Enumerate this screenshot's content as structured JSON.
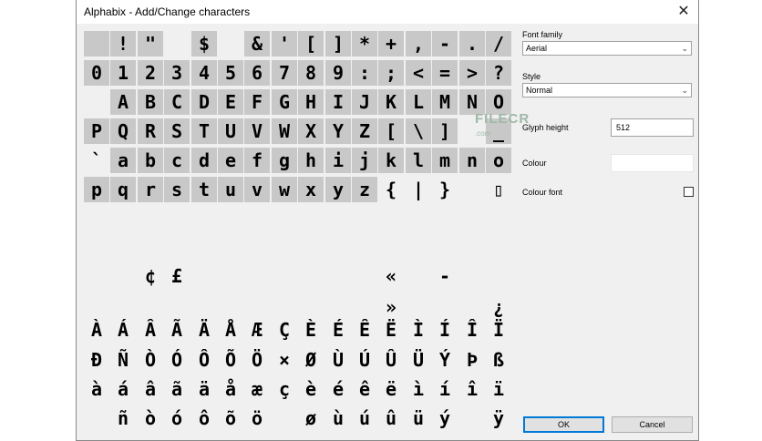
{
  "window": {
    "title": "Alphabix - Add/Change characters",
    "close_glyph": "✕"
  },
  "glyph_rows": [
    {
      "row": 0,
      "cells": [
        {
          "c": "",
          "f": true
        },
        {
          "c": "!",
          "f": true
        },
        {
          "c": "\"",
          "f": true
        },
        {
          "c": "",
          "f": false
        },
        {
          "c": "$",
          "f": true
        },
        {
          "c": "",
          "f": false
        },
        {
          "c": "&",
          "f": true
        },
        {
          "c": "'",
          "f": true
        },
        {
          "c": "[",
          "f": true
        },
        {
          "c": "]",
          "f": true
        },
        {
          "c": "*",
          "f": true
        },
        {
          "c": "+",
          "f": true
        },
        {
          "c": ",",
          "f": true
        },
        {
          "c": "-",
          "f": true
        },
        {
          "c": ".",
          "f": true
        },
        {
          "c": "/",
          "f": true
        }
      ]
    },
    {
      "row": 1,
      "cells": [
        {
          "c": "0",
          "f": true
        },
        {
          "c": "1",
          "f": true
        },
        {
          "c": "2",
          "f": true
        },
        {
          "c": "3",
          "f": true
        },
        {
          "c": "4",
          "f": true
        },
        {
          "c": "5",
          "f": true
        },
        {
          "c": "6",
          "f": true
        },
        {
          "c": "7",
          "f": true
        },
        {
          "c": "8",
          "f": true
        },
        {
          "c": "9",
          "f": true
        },
        {
          "c": ":",
          "f": true
        },
        {
          "c": ";",
          "f": true
        },
        {
          "c": "<",
          "f": true
        },
        {
          "c": "=",
          "f": true
        },
        {
          "c": ">",
          "f": true
        },
        {
          "c": "?",
          "f": true
        }
      ]
    },
    {
      "row": 2,
      "cells": [
        {
          "c": "",
          "f": false
        },
        {
          "c": "A",
          "f": true
        },
        {
          "c": "B",
          "f": true
        },
        {
          "c": "C",
          "f": true
        },
        {
          "c": "D",
          "f": true
        },
        {
          "c": "E",
          "f": true
        },
        {
          "c": "F",
          "f": true
        },
        {
          "c": "G",
          "f": true
        },
        {
          "c": "H",
          "f": true
        },
        {
          "c": "I",
          "f": true
        },
        {
          "c": "J",
          "f": true
        },
        {
          "c": "K",
          "f": true
        },
        {
          "c": "L",
          "f": true
        },
        {
          "c": "M",
          "f": true
        },
        {
          "c": "N",
          "f": true
        },
        {
          "c": "O",
          "f": true
        }
      ]
    },
    {
      "row": 3,
      "cells": [
        {
          "c": "P",
          "f": true
        },
        {
          "c": "Q",
          "f": true
        },
        {
          "c": "R",
          "f": true
        },
        {
          "c": "S",
          "f": true
        },
        {
          "c": "T",
          "f": true
        },
        {
          "c": "U",
          "f": true
        },
        {
          "c": "V",
          "f": true
        },
        {
          "c": "W",
          "f": true
        },
        {
          "c": "X",
          "f": true
        },
        {
          "c": "Y",
          "f": true
        },
        {
          "c": "Z",
          "f": true
        },
        {
          "c": "[",
          "f": true
        },
        {
          "c": "\\",
          "f": true
        },
        {
          "c": "]",
          "f": true
        },
        {
          "c": "",
          "f": false
        },
        {
          "c": "_",
          "f": true
        }
      ]
    },
    {
      "row": 4,
      "cells": [
        {
          "c": "`",
          "f": false
        },
        {
          "c": "a",
          "f": true
        },
        {
          "c": "b",
          "f": true
        },
        {
          "c": "c",
          "f": true
        },
        {
          "c": "d",
          "f": true
        },
        {
          "c": "e",
          "f": true
        },
        {
          "c": "f",
          "f": true
        },
        {
          "c": "g",
          "f": true
        },
        {
          "c": "h",
          "f": true
        },
        {
          "c": "i",
          "f": true
        },
        {
          "c": "j",
          "f": true
        },
        {
          "c": "k",
          "f": true
        },
        {
          "c": "l",
          "f": true
        },
        {
          "c": "m",
          "f": true
        },
        {
          "c": "n",
          "f": true
        },
        {
          "c": "o",
          "f": true
        }
      ]
    },
    {
      "row": 5,
      "cells": [
        {
          "c": "p",
          "f": true
        },
        {
          "c": "q",
          "f": true
        },
        {
          "c": "r",
          "f": true
        },
        {
          "c": "s",
          "f": true
        },
        {
          "c": "t",
          "f": true
        },
        {
          "c": "u",
          "f": true
        },
        {
          "c": "v",
          "f": true
        },
        {
          "c": "w",
          "f": true
        },
        {
          "c": "x",
          "f": true
        },
        {
          "c": "y",
          "f": true
        },
        {
          "c": "z",
          "f": true
        },
        {
          "c": "{",
          "f": false
        },
        {
          "c": "|",
          "f": false
        },
        {
          "c": "}",
          "f": false
        },
        {
          "c": "",
          "f": false
        },
        {
          "c": "▯",
          "f": false
        }
      ]
    },
    {
      "row": 6,
      "cells": [
        {
          "c": "",
          "f": false
        },
        {
          "c": "",
          "f": false
        },
        {
          "c": "",
          "f": false
        },
        {
          "c": "",
          "f": false
        },
        {
          "c": "",
          "f": false
        },
        {
          "c": "",
          "f": false
        },
        {
          "c": "",
          "f": false
        },
        {
          "c": "",
          "f": false
        },
        {
          "c": "",
          "f": false
        },
        {
          "c": "",
          "f": false
        },
        {
          "c": "",
          "f": false
        },
        {
          "c": "",
          "f": false
        },
        {
          "c": "",
          "f": false
        },
        {
          "c": "",
          "f": false
        },
        {
          "c": "",
          "f": false
        },
        {
          "c": "",
          "f": false
        }
      ]
    },
    {
      "row": 7,
      "cells": [
        {
          "c": "",
          "f": false
        },
        {
          "c": "",
          "f": false
        },
        {
          "c": "¢",
          "f": false
        },
        {
          "c": "£",
          "f": false
        },
        {
          "c": "",
          "f": false
        },
        {
          "c": "",
          "f": false
        },
        {
          "c": "",
          "f": false
        },
        {
          "c": "",
          "f": false
        },
        {
          "c": "",
          "f": false
        },
        {
          "c": "",
          "f": false
        },
        {
          "c": "",
          "f": false
        },
        {
          "c": "«",
          "f": false
        },
        {
          "c": "",
          "f": false
        },
        {
          "c": "-",
          "f": false
        },
        {
          "c": "",
          "f": false
        },
        {
          "c": "",
          "f": false
        }
      ]
    },
    {
      "row": 8,
      "cells": [
        {
          "c": "",
          "f": false
        },
        {
          "c": "",
          "f": false
        },
        {
          "c": "",
          "f": false
        },
        {
          "c": "",
          "f": false
        },
        {
          "c": "",
          "f": false
        },
        {
          "c": "",
          "f": false
        },
        {
          "c": "",
          "f": false
        },
        {
          "c": "",
          "f": false
        },
        {
          "c": "",
          "f": false
        },
        {
          "c": "",
          "f": false
        },
        {
          "c": "",
          "f": false
        },
        {
          "c": "»",
          "f": false
        },
        {
          "c": "",
          "f": false
        },
        {
          "c": "",
          "f": false
        },
        {
          "c": "",
          "f": false
        },
        {
          "c": "¿",
          "f": false
        }
      ]
    },
    {
      "row": 9,
      "cells": [
        {
          "c": "À",
          "f": false
        },
        {
          "c": "Á",
          "f": false
        },
        {
          "c": "Â",
          "f": false
        },
        {
          "c": "Ã",
          "f": false
        },
        {
          "c": "Ä",
          "f": false
        },
        {
          "c": "Å",
          "f": false
        },
        {
          "c": "Æ",
          "f": false
        },
        {
          "c": "Ç",
          "f": false
        },
        {
          "c": "È",
          "f": false
        },
        {
          "c": "É",
          "f": false
        },
        {
          "c": "Ê",
          "f": false
        },
        {
          "c": "Ë",
          "f": false
        },
        {
          "c": "Ì",
          "f": false
        },
        {
          "c": "Í",
          "f": false
        },
        {
          "c": "Î",
          "f": false
        },
        {
          "c": "Ï",
          "f": false
        }
      ]
    },
    {
      "row": 10,
      "cells": [
        {
          "c": "Ð",
          "f": false
        },
        {
          "c": "Ñ",
          "f": false
        },
        {
          "c": "Ò",
          "f": false
        },
        {
          "c": "Ó",
          "f": false
        },
        {
          "c": "Ô",
          "f": false
        },
        {
          "c": "Õ",
          "f": false
        },
        {
          "c": "Ö",
          "f": false
        },
        {
          "c": "×",
          "f": false
        },
        {
          "c": "Ø",
          "f": false
        },
        {
          "c": "Ù",
          "f": false
        },
        {
          "c": "Ú",
          "f": false
        },
        {
          "c": "Û",
          "f": false
        },
        {
          "c": "Ü",
          "f": false
        },
        {
          "c": "Ý",
          "f": false
        },
        {
          "c": "Þ",
          "f": false
        },
        {
          "c": "ß",
          "f": false
        }
      ]
    },
    {
      "row": 11,
      "cells": [
        {
          "c": "à",
          "f": false
        },
        {
          "c": "á",
          "f": false
        },
        {
          "c": "â",
          "f": false
        },
        {
          "c": "ã",
          "f": false
        },
        {
          "c": "ä",
          "f": false
        },
        {
          "c": "å",
          "f": false
        },
        {
          "c": "æ",
          "f": false
        },
        {
          "c": "ç",
          "f": false
        },
        {
          "c": "è",
          "f": false
        },
        {
          "c": "é",
          "f": false
        },
        {
          "c": "ê",
          "f": false
        },
        {
          "c": "ë",
          "f": false
        },
        {
          "c": "ì",
          "f": false
        },
        {
          "c": "í",
          "f": false
        },
        {
          "c": "î",
          "f": false
        },
        {
          "c": "ï",
          "f": false
        }
      ]
    },
    {
      "row": 12,
      "cells": [
        {
          "c": "",
          "f": false
        },
        {
          "c": "ñ",
          "f": false
        },
        {
          "c": "ò",
          "f": false
        },
        {
          "c": "ó",
          "f": false
        },
        {
          "c": "ô",
          "f": false
        },
        {
          "c": "õ",
          "f": false
        },
        {
          "c": "ö",
          "f": false
        },
        {
          "c": "",
          "f": false
        },
        {
          "c": "ø",
          "f": false
        },
        {
          "c": "ù",
          "f": false
        },
        {
          "c": "ú",
          "f": false
        },
        {
          "c": "û",
          "f": false
        },
        {
          "c": "ü",
          "f": false
        },
        {
          "c": "ý",
          "f": false
        },
        {
          "c": "",
          "f": false
        },
        {
          "c": "ÿ",
          "f": false
        }
      ]
    }
  ],
  "panel": {
    "font_family_label": "Font family",
    "font_family_value": "Aerial",
    "style_label": "Style",
    "style_value": "Normal",
    "glyph_height_label": "Glyph height",
    "glyph_height_value": "512",
    "colour_label": "Colour",
    "colour_font_label": "Colour font",
    "ok_label": "OK",
    "cancel_label": "Cancel"
  },
  "watermark": {
    "text": "FILECR",
    "sub": ".com"
  },
  "colors": {
    "cell_fill": "#c8c8c8",
    "window_bg": "#f0f0f0",
    "accent": "#0078d7"
  }
}
